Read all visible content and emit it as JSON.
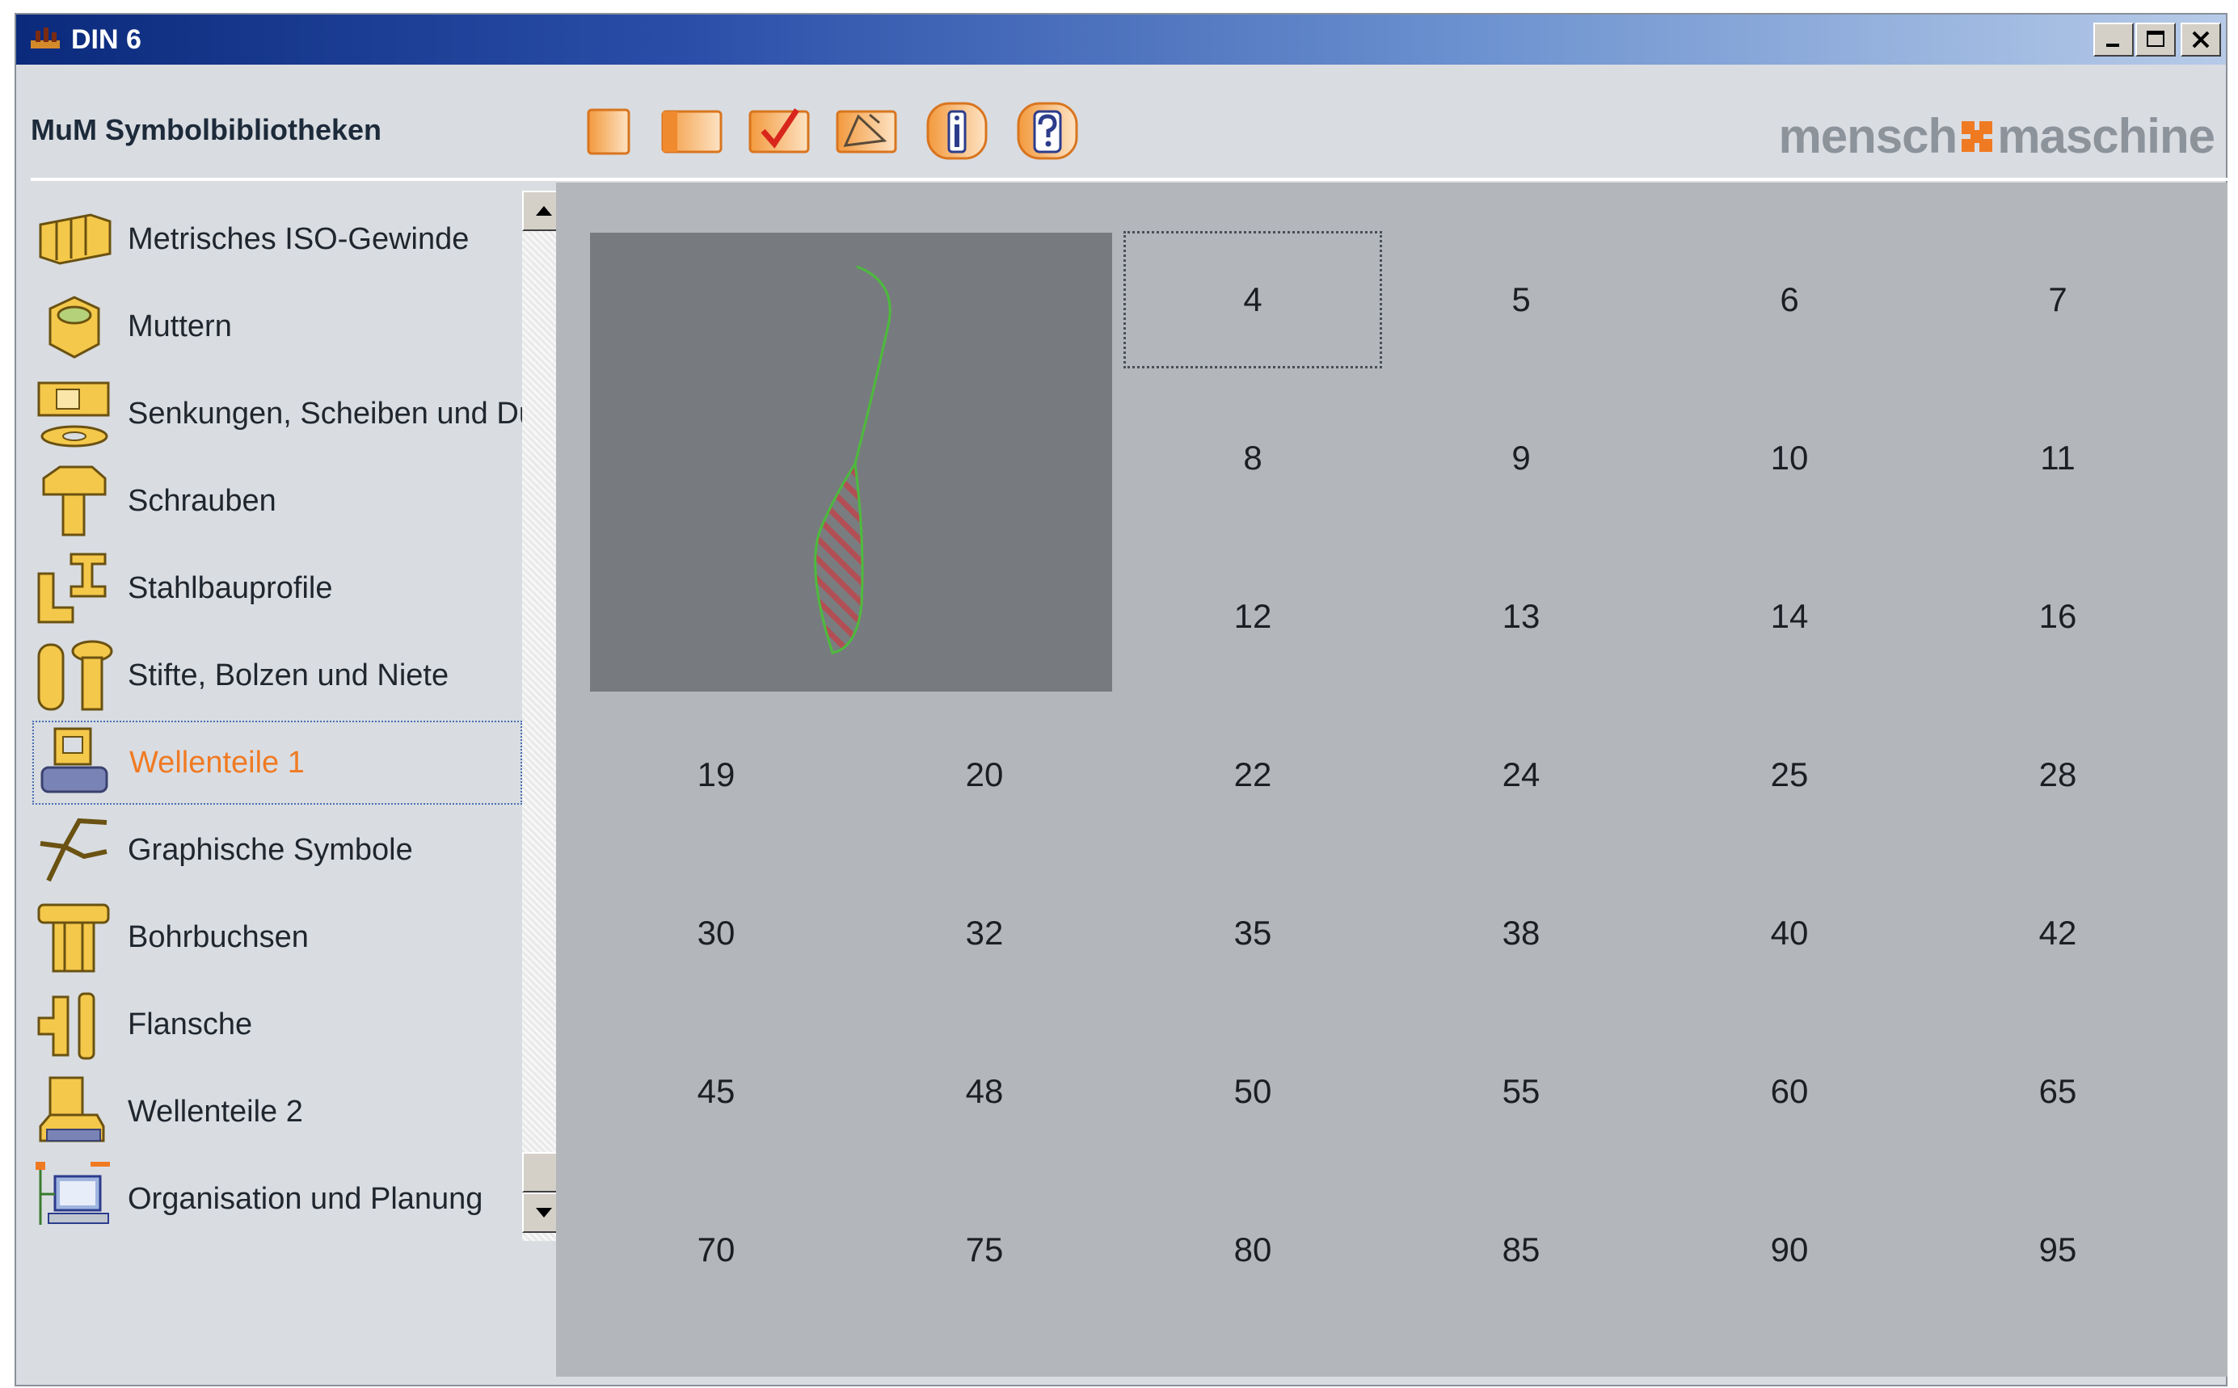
{
  "window": {
    "title": "DIN 6",
    "buttons": [
      "minimize-button",
      "maximize-button",
      "close-button"
    ]
  },
  "header": {
    "label": "MuM Symbolbibliotheken",
    "toolbar": [
      {
        "name": "new-button",
        "icon": "blank-page-icon"
      },
      {
        "name": "open-button",
        "icon": "panel-icon"
      },
      {
        "name": "check-button",
        "icon": "checkmark-icon"
      },
      {
        "name": "measure-button",
        "icon": "angle-icon"
      },
      {
        "name": "info-button",
        "icon": "info-icon"
      },
      {
        "name": "help-button",
        "icon": "question-icon"
      }
    ],
    "logo_left": "mensch",
    "logo_right": "maschine"
  },
  "sidebar": {
    "items": [
      {
        "label": "Metrisches ISO-Gewinde",
        "icon": "thread-icon"
      },
      {
        "label": "Muttern",
        "icon": "nut-icon"
      },
      {
        "label": "Senkungen, Scheiben und Du",
        "icon": "washer-icon"
      },
      {
        "label": "Schrauben",
        "icon": "screw-icon"
      },
      {
        "label": "Stahlbauprofile",
        "icon": "steel-profile-icon"
      },
      {
        "label": "Stifte, Bolzen und Niete",
        "icon": "pin-icon"
      },
      {
        "label": "Wellenteile 1",
        "icon": "shaft-part-icon",
        "selected": true
      },
      {
        "label": "Graphische Symbole",
        "icon": "graphic-symbol-icon"
      },
      {
        "label": "Bohrbuchsen",
        "icon": "drill-bushing-icon"
      },
      {
        "label": "Flansche",
        "icon": "flange-icon"
      },
      {
        "label": "Wellenteile 2",
        "icon": "shaft-part-2-icon"
      },
      {
        "label": "Organisation und Planung",
        "icon": "organisation-icon"
      }
    ]
  },
  "grid": {
    "focused": "4",
    "row1": [
      "4",
      "5",
      "6",
      "7"
    ],
    "row2": [
      "8",
      "9",
      "10",
      "11"
    ],
    "row3": [
      "12",
      "13",
      "14",
      "16"
    ],
    "row4": [
      "19",
      "20",
      "22",
      "24",
      "25",
      "28"
    ],
    "row5": [
      "30",
      "32",
      "35",
      "38",
      "40",
      "42"
    ],
    "row6": [
      "45",
      "48",
      "50",
      "55",
      "60",
      "65"
    ],
    "row7": [
      "70",
      "75",
      "80",
      "85",
      "90",
      "95"
    ]
  },
  "colors": {
    "accent": "#f07a22",
    "content_bg": "#b3b7bb",
    "preview_bg": "#777b7f"
  }
}
